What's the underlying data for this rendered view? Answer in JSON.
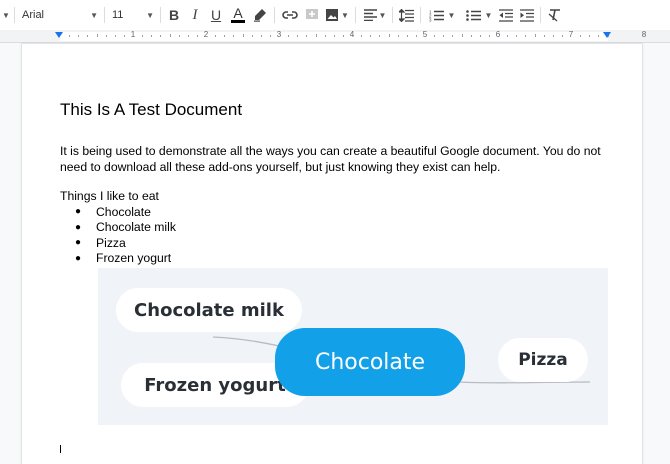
{
  "toolbar": {
    "font_family": "Arial",
    "font_size": "11",
    "bold_label": "B",
    "italic_label": "I",
    "underline_label": "U",
    "text_color_label": "A",
    "text_color": "#000000"
  },
  "ruler": {
    "numbers": [
      "1",
      "2",
      "3",
      "4",
      "5",
      "6",
      "7",
      "8"
    ]
  },
  "document": {
    "title": "This Is A Test Document",
    "paragraph": "It is being used to demonstrate all the ways you can create a beautiful Google document. You do not need to download all these add-ons yourself, but just knowing they exist can help.",
    "list_heading": "Things I like to eat",
    "list_items": [
      "Chocolate",
      "Chocolate milk",
      "Pizza",
      "Frozen yogurt"
    ]
  },
  "mindmap": {
    "central_topic": "Chocolate",
    "subtopics": [
      "Chocolate milk",
      "Frozen yogurt",
      "Pizza"
    ],
    "central_color": "#12a0e8",
    "background_color": "#f0f4f8"
  },
  "icons": [
    "menu-caret-icon",
    "link-icon",
    "comment-icon",
    "image-icon",
    "align-icon",
    "line-spacing-icon",
    "numbered-list-icon",
    "bulleted-list-icon",
    "decrease-indent-icon",
    "increase-indent-icon",
    "clear-formatting-icon"
  ]
}
